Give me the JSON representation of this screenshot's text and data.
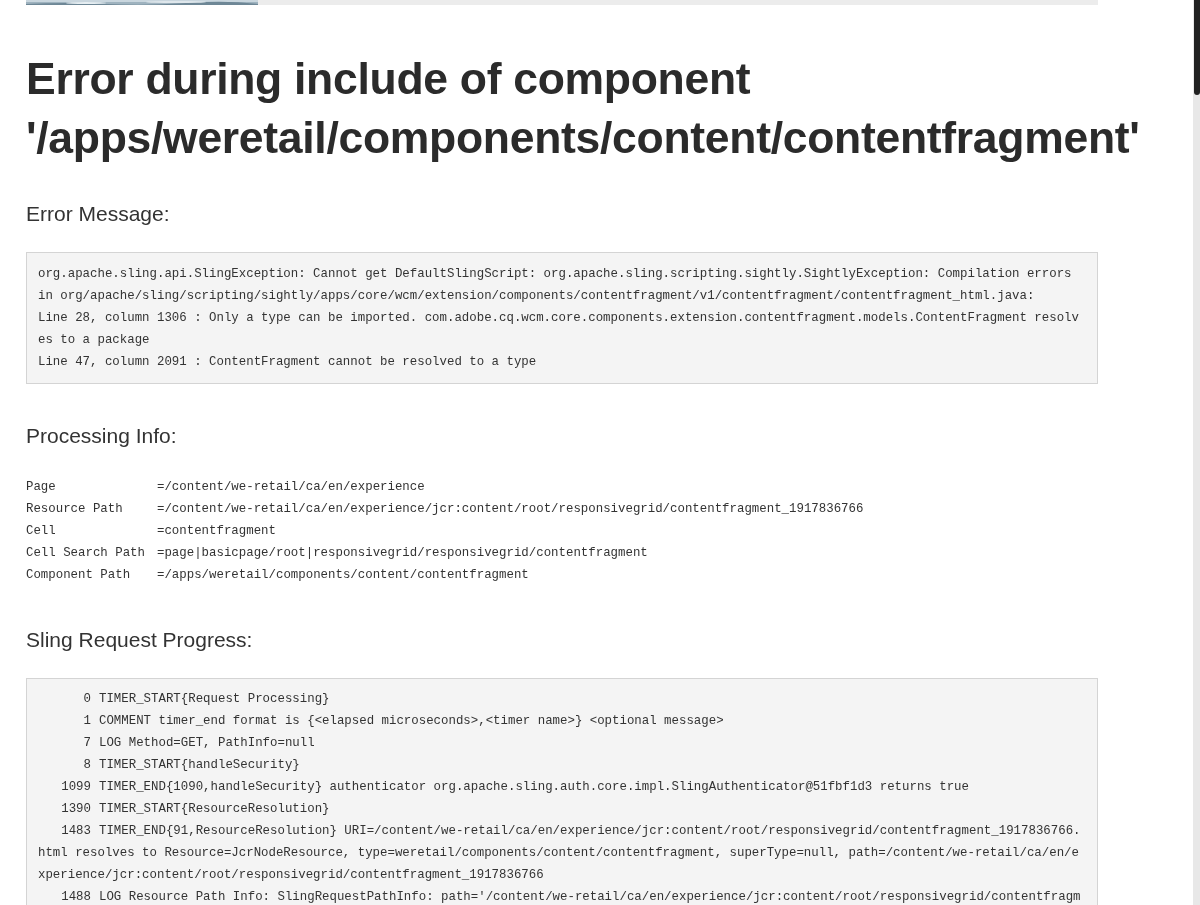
{
  "heading": {
    "lines": [
      "Error during include of component",
      "'/apps/weretail/components/content/contentfragment'"
    ]
  },
  "error_message": {
    "title": "Error Message:",
    "lines": [
      "org.apache.sling.api.SlingException: Cannot get DefaultSlingScript: org.apache.sling.scripting.sightly.SightlyException: Compilation errors",
      "in org/apache/sling/scripting/sightly/apps/core/wcm/extension/components/contentfragment/v1/contentfragment/contentfragment_html.java:",
      "Line 28, column 1306 : Only a type can be imported. com.adobe.cq.wcm.core.components.extension.contentfragment.models.ContentFragment resolv",
      "es to a package",
      "Line 47, column 2091 : ContentFragment cannot be resolved to a type"
    ]
  },
  "processing_info": {
    "title": "Processing Info:",
    "rows": [
      {
        "label": "Page",
        "value": "=/content/we-retail/ca/en/experience"
      },
      {
        "label": "Resource Path",
        "value": "=/content/we-retail/ca/en/experience/jcr:content/root/responsivegrid/contentfragment_1917836766"
      },
      {
        "label": "Cell",
        "value": "=contentfragment"
      },
      {
        "label": "Cell Search Path",
        "value": "=page|basicpage/root|responsivegrid/responsivegrid/contentfragment"
      },
      {
        "label": "Component Path",
        "value": "=/apps/weretail/components/content/contentfragment"
      }
    ]
  },
  "request_progress": {
    "title": "Sling Request Progress:",
    "lines": [
      {
        "kind": "entry",
        "time": "0",
        "text": "TIMER_START{Request Processing}"
      },
      {
        "kind": "entry",
        "time": "1",
        "text": "COMMENT timer_end format is {<elapsed microseconds>,<timer name>} <optional message>"
      },
      {
        "kind": "entry",
        "time": "7",
        "text": "LOG Method=GET, PathInfo=null"
      },
      {
        "kind": "entry",
        "time": "8",
        "text": "TIMER_START{handleSecurity}"
      },
      {
        "kind": "entry",
        "time": "1099",
        "text": "TIMER_END{1090,handleSecurity} authenticator org.apache.sling.auth.core.impl.SlingAuthenticator@51fbf1d3 returns true"
      },
      {
        "kind": "entry",
        "time": "1390",
        "text": "TIMER_START{ResourceResolution}"
      },
      {
        "kind": "entry",
        "time": "1483",
        "text": "TIMER_END{91,ResourceResolution} URI=/content/we-retail/ca/en/experience/jcr:content/root/responsivegrid/contentfragment_1917836766."
      },
      {
        "kind": "continuation",
        "text": "html resolves to Resource=JcrNodeResource, type=weretail/components/content/contentfragment, superType=null, path=/content/we-retail/ca/en/e"
      },
      {
        "kind": "continuation",
        "text": "xperience/jcr:content/root/responsivegrid/contentfragment_1917836766"
      },
      {
        "kind": "entry",
        "time": "1488",
        "text": "LOG Resource Path Info: SlingRequestPathInfo: path='/content/we-retail/ca/en/experience/jcr:content/root/responsivegrid/contentfragm"
      }
    ]
  }
}
